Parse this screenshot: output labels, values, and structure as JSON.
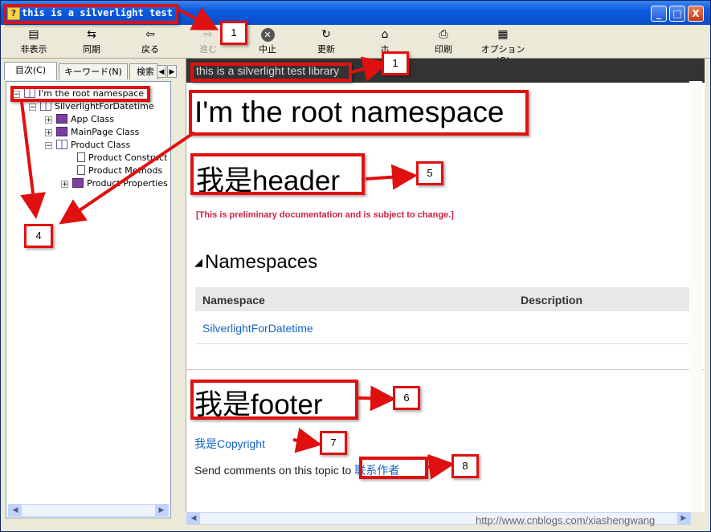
{
  "window": {
    "title": "this is a silverlight test library",
    "title_visible": "this is a silverlight test librar",
    "controls": {
      "minimize": "_",
      "maximize": "□",
      "close": "X"
    }
  },
  "toolbar": [
    {
      "id": "hide",
      "label": "非表示",
      "icon": "hide-icon"
    },
    {
      "id": "sync",
      "label": "同期",
      "icon": "sync-icon"
    },
    {
      "id": "back",
      "label": "戻る",
      "icon": "back-arrow-icon"
    },
    {
      "id": "forward",
      "label": "進む",
      "icon": "forward-arrow-icon",
      "disabled": true
    },
    {
      "id": "stop",
      "label": "中止",
      "icon": "stop-icon"
    },
    {
      "id": "refresh",
      "label": "更新",
      "icon": "refresh-icon"
    },
    {
      "id": "home",
      "label": "ホーム",
      "label_visible": "ホ",
      "icon": "home-icon"
    },
    {
      "id": "print",
      "label": "印刷",
      "icon": "print-icon"
    },
    {
      "id": "options",
      "label": "オプション(O)",
      "icon": "options-icon"
    }
  ],
  "nav_tabs": [
    {
      "label": "目次(C)",
      "active": true
    },
    {
      "label": "キーワード(N)",
      "active": false
    },
    {
      "label": "検索",
      "active": false
    }
  ],
  "tree": [
    {
      "label": "I'm the root namespace",
      "expander": "−",
      "icon": "book-open-icon"
    },
    {
      "label": "SilverlightForDatetime",
      "expander": "−",
      "icon": "book-open-icon"
    },
    {
      "label": "App Class",
      "expander": "+",
      "icon": "book-icon"
    },
    {
      "label": "MainPage Class",
      "expander": "+",
      "icon": "book-icon"
    },
    {
      "label": "Product Class",
      "expander": "−",
      "icon": "book-open-icon"
    },
    {
      "label": "Product Constructor",
      "expander": "",
      "icon": "page-icon"
    },
    {
      "label": "Product Methods",
      "expander": "",
      "icon": "page-icon"
    },
    {
      "label": "Product Properties",
      "expander": "+",
      "icon": "book-icon"
    }
  ],
  "content": {
    "topbar_title": "this is a silverlight test library",
    "heading": "I'm the root namespace",
    "header_text": "我是header",
    "preliminary": "[This is preliminary documentation and is subject to change.]",
    "section_title": "Namespaces",
    "table": {
      "columns": [
        "Namespace",
        "Description"
      ],
      "rows": [
        {
          "namespace": "SilverlightForDatetime",
          "description": ""
        }
      ]
    },
    "footer_text": "我是footer",
    "copyright": "我是Copyright",
    "send_comments": "Send comments on this topic to",
    "contact_link": "联系作者"
  },
  "callouts": [
    "1",
    "1",
    "4",
    "5",
    "6",
    "7",
    "8"
  ],
  "watermark": "http://www.cnblogs.com/xiashengwang",
  "colors": {
    "annotation": "#e01010",
    "link": "#1364c4",
    "warning": "#cc1f43",
    "topbar": "#333333"
  }
}
